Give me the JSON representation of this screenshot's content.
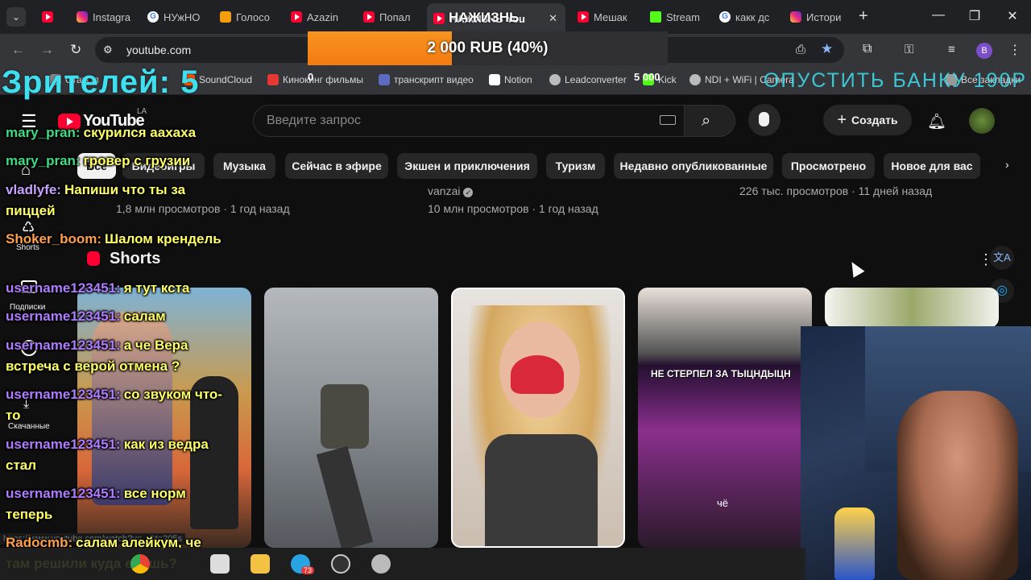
{
  "browser": {
    "tabs": [
      {
        "label": "",
        "icon": "youtube-icon"
      },
      {
        "label": "Instagra",
        "icon": "instagram-icon"
      },
      {
        "label": "НУжНО",
        "icon": "google-icon"
      },
      {
        "label": "Голосо",
        "icon": "d-icon"
      },
      {
        "label": "Azazin",
        "icon": "youtube-icon"
      },
      {
        "label": "Попал",
        "icon": "youtube-icon"
      },
      {
        "label": "НАЖИЗНЬ You",
        "icon": "youtube-icon"
      },
      {
        "label": "Мешак",
        "icon": "youtube-icon"
      },
      {
        "label": "Stream",
        "icon": "kick-icon"
      },
      {
        "label": "какк дс",
        "icon": "google-icon"
      },
      {
        "label": "Истори",
        "icon": "instagram-icon"
      }
    ],
    "url": "youtube.com",
    "bookmarks": [
      "СтатСл",
      "SoundCloud",
      "Кинокинг фильмы",
      "транскрипт видео",
      "Notion",
      "Leadconverter",
      "Kick",
      "NDI + WiFi | Camera",
      "Все закладки"
    ],
    "profile_letter": "B"
  },
  "youtube": {
    "logo_text": "YouTube",
    "region": "LA",
    "search_placeholder": "Введите запрос",
    "create_label": "Создать",
    "chips": [
      "Все",
      "Видеоигры",
      "Музыка",
      "Сейчас в эфире",
      "Экшен и приключения",
      "Туризм",
      "Недавно опубликованные",
      "Просмотрено",
      "Новое для вас"
    ],
    "video_meta": [
      {
        "line1": "",
        "line2": "1,8 млн просмотров · 1 год назад"
      },
      {
        "line1": "vanzai",
        "line2": "10 млн просмотров · 1 год назад"
      },
      {
        "line1": "226 тыс. просмотров · 11 дней назад",
        "line2": ""
      }
    ],
    "shorts_title": "Shorts",
    "sidebar": [
      "Shorts",
      "Подписки",
      "Скачанные"
    ],
    "status_url": "https://www.youtube.com/watch?v=...&t=205s"
  },
  "overlay": {
    "viewers": "Зрителей: 5",
    "donation": {
      "text": "2 000 RUB (40%)",
      "min": "0",
      "max": "5 000",
      "progress": 0.4,
      "label_top": "НАЖИЗНЬ"
    },
    "goal_right": "ОПУСТИТЬ БАНКУ 190Р",
    "chat": [
      {
        "user": "mary_pran:",
        "msg": "скурился аахаха",
        "color": "#3ddc84"
      },
      {
        "user": "mary_pran:",
        "msg": "гровер с грузии",
        "color": "#3ddc84"
      },
      {
        "user": "vladlyfe:",
        "msg": "Напиши что ты за пиццей",
        "color": "#c8a2ff"
      },
      {
        "user": "Shoker_boom:",
        "msg": "Шалом крендель",
        "color": "#ffa04a"
      },
      {
        "user": "username123451:",
        "msg": "я тут кста",
        "color": "#b07cff"
      },
      {
        "user": "username123451:",
        "msg": "салам",
        "color": "#b07cff"
      },
      {
        "user": "username123451:",
        "msg": "а че Вера встреча с верой отмена ?",
        "color": "#b07cff"
      },
      {
        "user": "username123451:",
        "msg": "со звуком что-то",
        "color": "#b07cff"
      },
      {
        "user": "username123451:",
        "msg": "как из ведра стал",
        "color": "#b07cff"
      },
      {
        "user": "username123451:",
        "msg": "все норм теперь",
        "color": "#b07cff"
      },
      {
        "user": "Radocmb:",
        "msg": "салам алейкум, че там решили куда едешь?",
        "color": "#ffa04a"
      }
    ],
    "short_caption": "НЕ СТЕРПЕЛ ЗА ТЫЦНДЫЦН",
    "short_sub": "чё"
  },
  "taskbar": {
    "badge": "73"
  }
}
